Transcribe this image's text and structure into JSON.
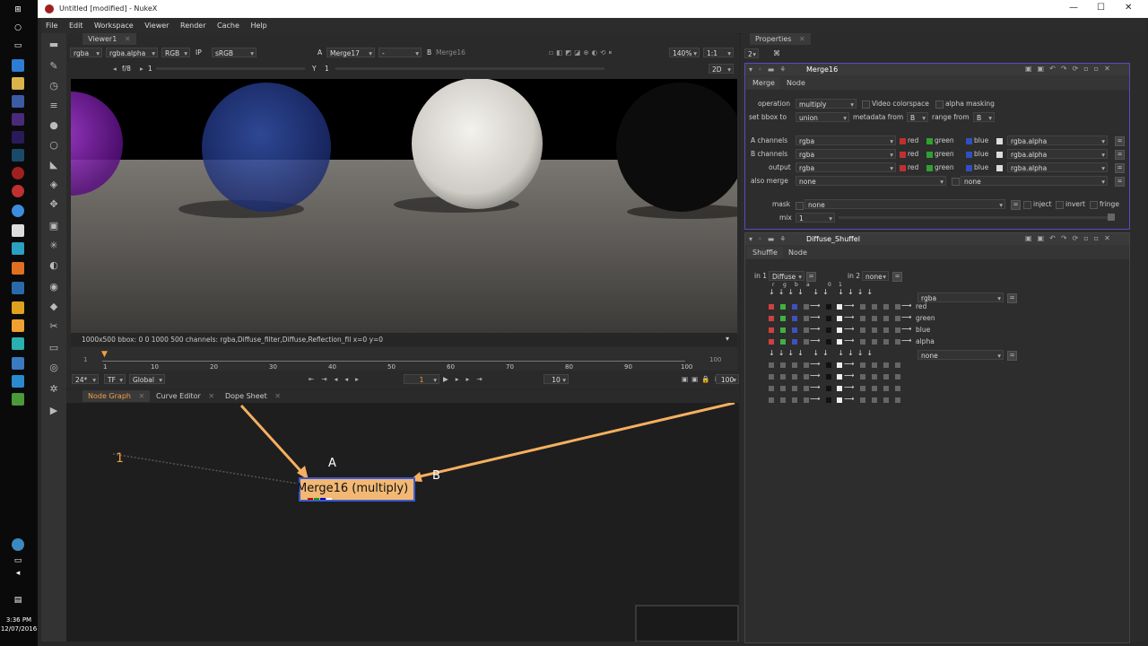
{
  "window": {
    "title": "Untitled [modified] - NukeX",
    "minimize": "—",
    "maximize": "☐",
    "close": "✕"
  },
  "menu": [
    "File",
    "Edit",
    "Workspace",
    "Viewer",
    "Render",
    "Cache",
    "Help"
  ],
  "viewer": {
    "tab": "Viewer1",
    "channels": "rgba",
    "alpha": "rgba.alpha",
    "display": "RGB",
    "ip": "IP",
    "lut": "sRGB",
    "a_label": "A",
    "a_input": "Merge17",
    "a_op": "-",
    "b_label": "B",
    "b_input": "Merge16",
    "zoom": "140%",
    "ratio": "1:1",
    "mode": "2D",
    "fstop": "f/8",
    "gain": "1",
    "y_label": "Y",
    "gamma": "1",
    "info": "1000x500  bbox: 0 0 1000 500 channels: rgba,Diffuse_filter,Diffuse,Reflection_fil  x=0 y=0"
  },
  "timeline": {
    "start": "1",
    "ticks": [
      "1",
      "10",
      "20",
      "30",
      "40",
      "50",
      "60",
      "70",
      "80",
      "90",
      "100"
    ],
    "end": "100",
    "fps": "24*",
    "tf": "TF",
    "scope": "Global",
    "frame": "1",
    "step": "10",
    "out": "100"
  },
  "nodegraph": {
    "tabs": [
      "Node Graph",
      "Curve Editor",
      "Dope Sheet"
    ],
    "node_label": "Merge16 (multiply)",
    "input_a": "A",
    "input_b": "B",
    "viewer_input": "1"
  },
  "properties": {
    "title": "Properties",
    "count": "2",
    "merge": {
      "name": "Merge16",
      "tabs": [
        "Merge",
        "Node"
      ],
      "operation_label": "operation",
      "operation": "multiply",
      "video_colorspace": "Video colorspace",
      "alpha_masking": "alpha masking",
      "bbox_label": "set bbox to",
      "bbox": "union",
      "metadata_label": "metadata from",
      "metadata": "B",
      "range_label": "range from",
      "range": "B",
      "a_channels_label": "A channels",
      "b_channels_label": "B channels",
      "output_label": "output",
      "channels": "rgba",
      "red": "red",
      "green": "green",
      "blue": "blue",
      "alpha_ch": "rgba.alpha",
      "also_merge_label": "also merge",
      "none": "none",
      "mask_label": "mask",
      "inject": "inject",
      "invert": "invert",
      "fringe": "fringe",
      "mix_label": "mix",
      "mix": "1"
    },
    "shuffle": {
      "name": "Diffuse_Shuffel",
      "tabs": [
        "Shuffle",
        "Node"
      ],
      "in1_label": "in 1",
      "in1": "Diffuse",
      "in2_label": "in 2",
      "in2": "none",
      "col_heads": [
        "r",
        "g",
        "b",
        "a",
        "0",
        "1"
      ],
      "out1": "rgba",
      "out2": "none",
      "rows": [
        "red",
        "green",
        "blue",
        "alpha"
      ]
    }
  },
  "clock": {
    "time": "3:36 PM",
    "date": "12/07/2016"
  }
}
